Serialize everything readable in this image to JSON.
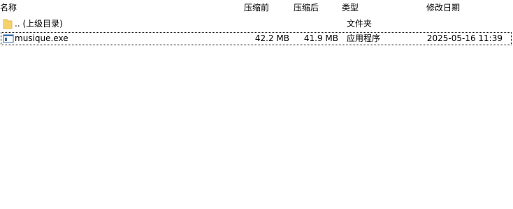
{
  "columns": {
    "name": "名称",
    "packed": "压缩前",
    "size": "压缩后",
    "type": "类型",
    "modified": "修改日期"
  },
  "rows": [
    {
      "icon": "folder-icon",
      "name": ".. (上级目录)",
      "packed": "",
      "size": "",
      "type": "文件夹",
      "modified": ""
    },
    {
      "icon": "exe-icon",
      "name": "musique.exe",
      "packed": "42.2 MB",
      "size": "41.9 MB",
      "type": "应用程序",
      "modified": "2025-05-16 11:39"
    }
  ],
  "colors": {
    "folder": "#f6d26b",
    "folder_dark": "#e6b94a",
    "exe_frame": "#3a6ea5"
  }
}
